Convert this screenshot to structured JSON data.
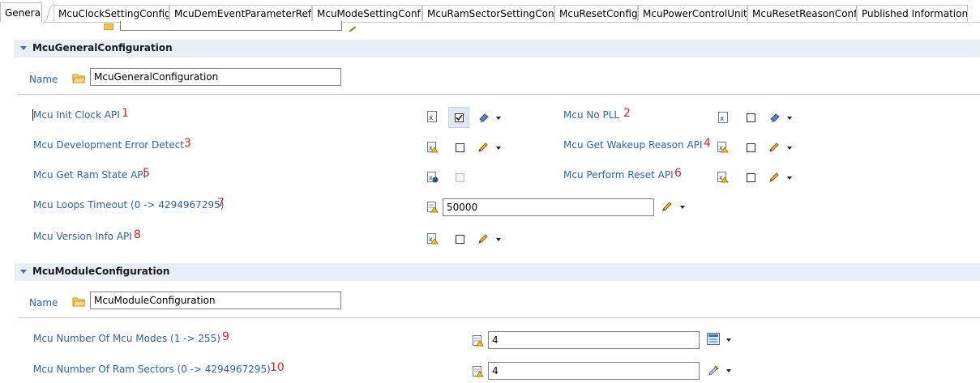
{
  "tabs": [
    "General",
    "McuClockSettingConfig",
    "McuDemEventParameterRefs",
    "McuModeSettingConf",
    "McuRamSectorSettingConf",
    "McuResetConfig",
    "McuPowerControlUnit",
    "McuResetReasonConf",
    "Published Information"
  ],
  "general_section": {
    "title": "McuGeneralConfiguration",
    "name_label": "Name",
    "name_value": "McuGeneralConfiguration",
    "params": {
      "init_clock": {
        "label": "Mcu Init Clock API",
        "marker": "1",
        "checked": true
      },
      "no_pll": {
        "label": "Mcu No PLL",
        "marker": "2",
        "checked": false
      },
      "dev_error": {
        "label": "Mcu Development Error Detect",
        "marker": "3",
        "checked": false
      },
      "wakeup_reason": {
        "label": "Mcu Get Wakeup Reason API",
        "marker": "4",
        "checked": false
      },
      "ram_state": {
        "label": "Mcu Get Ram State API",
        "marker": "5",
        "checked": false
      },
      "perform_reset": {
        "label": "Mcu Perform Reset API",
        "marker": "6",
        "checked": false
      },
      "loops_timeout": {
        "label": "Mcu Loops Timeout (0 -> 4294967295)",
        "marker": "7",
        "value": "50000"
      },
      "version_info": {
        "label": "Mcu Version Info API",
        "marker": "8",
        "checked": false
      }
    }
  },
  "module_section": {
    "title": "McuModuleConfiguration",
    "name_label": "Name",
    "name_value": "McuModuleConfiguration",
    "params": {
      "num_modes": {
        "label": "Mcu Number Of Mcu Modes (1 -> 255)",
        "marker": "9",
        "value": "4"
      },
      "num_ram_sectors": {
        "label": "Mcu Number Of Ram Sectors (0 -> 4294967295)",
        "marker": "10",
        "value": "4"
      }
    }
  },
  "colors": {
    "label_blue": "#2a62b7",
    "marker_red": "#e02020",
    "section_bg": "#eaeff7"
  }
}
